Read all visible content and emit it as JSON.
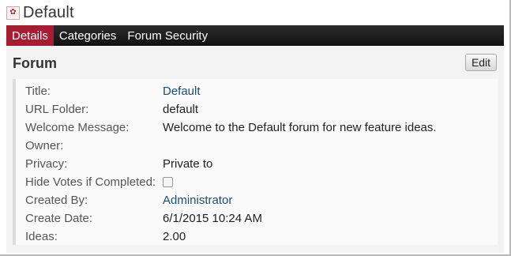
{
  "window": {
    "title": "Default",
    "icon": "forum-icon"
  },
  "tabs": [
    {
      "label": "Details",
      "active": true
    },
    {
      "label": "Categories",
      "active": false
    },
    {
      "label": "Forum Security",
      "active": false
    }
  ],
  "section": {
    "heading": "Forum",
    "edit_label": "Edit"
  },
  "details": {
    "title_label": "Title:",
    "title_value": "Default",
    "url_label": "URL Folder:",
    "url_value": "default",
    "welcome_label": "Welcome Message:",
    "welcome_value": "Welcome to the Default forum for new feature ideas.",
    "owner_label": "Owner:",
    "owner_value": "",
    "privacy_label": "Privacy:",
    "privacy_value": "Private to",
    "hide_votes_label": "Hide Votes if Completed:",
    "hide_votes_checked": false,
    "created_by_label": "Created By:",
    "created_by_value": "Administrator",
    "create_date_label": "Create Date:",
    "create_date_value": "6/1/2015 10:24 AM",
    "ideas_label": "Ideas:",
    "ideas_value": "2.00"
  },
  "colors": {
    "accent": "#a71c33",
    "link": "#1f4e6f",
    "nav_bar": "#1a1a1a"
  }
}
